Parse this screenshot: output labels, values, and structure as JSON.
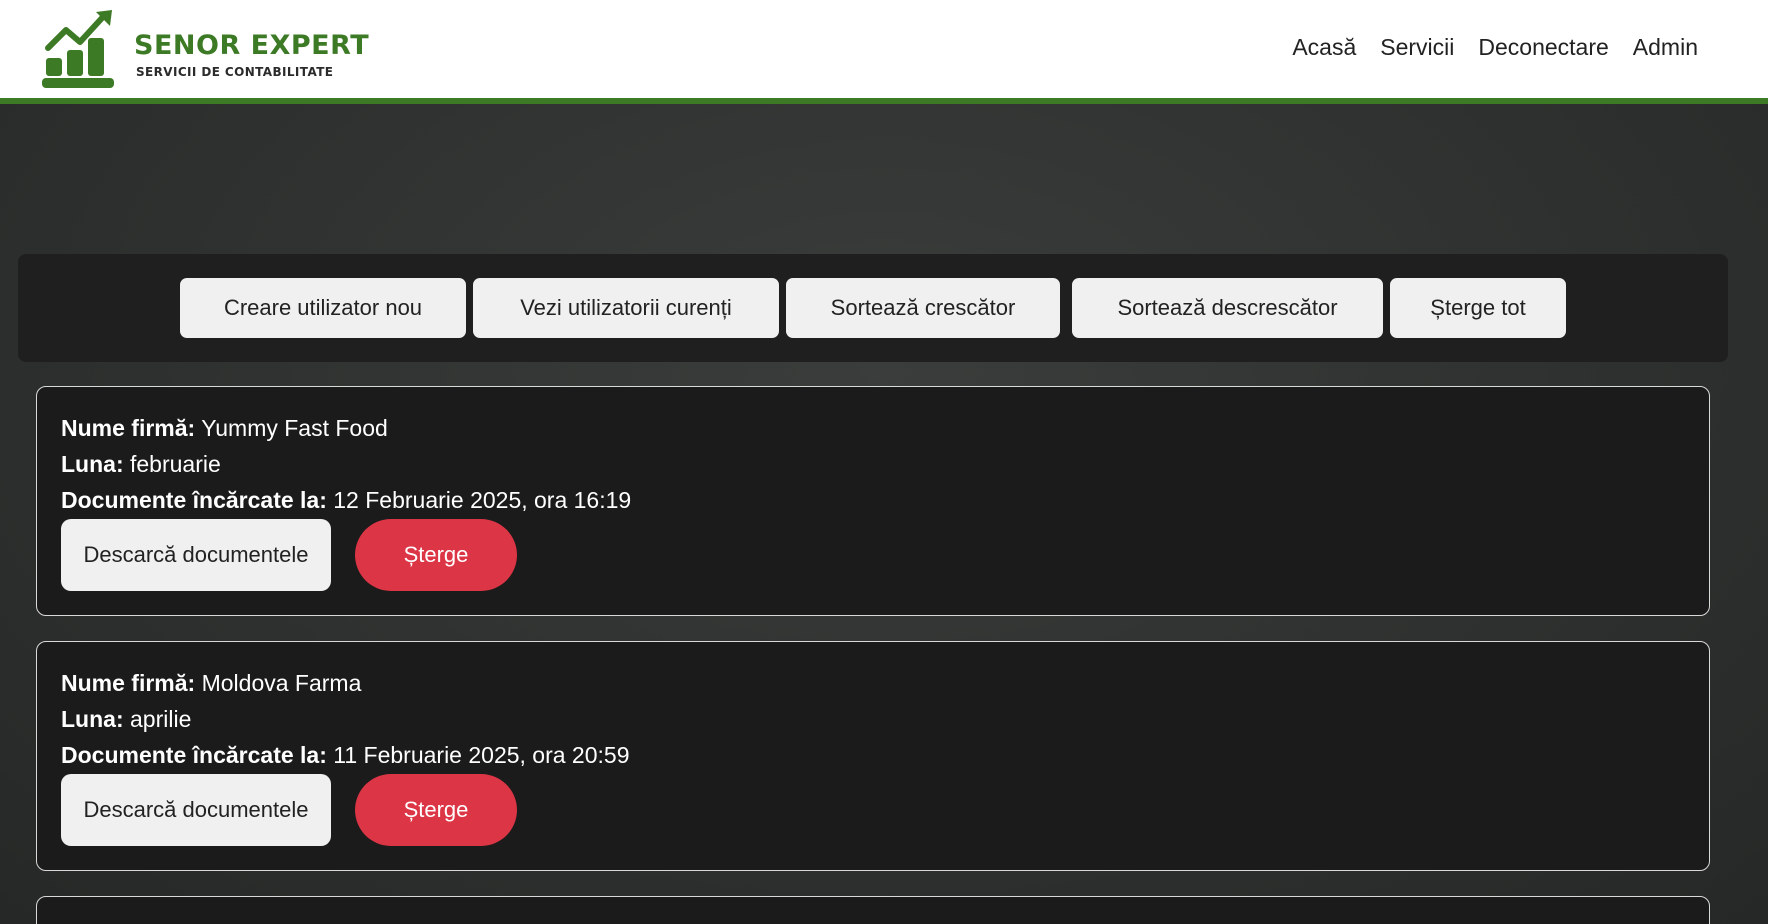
{
  "brand": {
    "title": "SENOR EXPERT",
    "subtitle": "SERVICII DE CONTABILITATE",
    "accent": "#3d7a25"
  },
  "nav": {
    "home": "Acasă",
    "services": "Servicii",
    "logout": "Deconectare",
    "admin": "Admin"
  },
  "toolbar": {
    "create_user": "Creare utilizator nou",
    "view_users": "Vezi utilizatorii curenți",
    "sort_asc": "Sortează crescător",
    "sort_desc": "Sortează descrescător",
    "delete_all": "Șterge tot"
  },
  "labels": {
    "company": "Nume firmă:",
    "month": "Luna:",
    "uploaded": "Documente încărcate la:",
    "download": "Descarcă documentele",
    "delete": "Șterge"
  },
  "records": [
    {
      "company": "Yummy Fast Food",
      "month": "februarie",
      "uploaded": "12 Februarie 2025, ora 16:19"
    },
    {
      "company": "Moldova Farma",
      "month": "aprilie",
      "uploaded": "11 Februarie 2025, ora 20:59"
    }
  ],
  "colors": {
    "delete": "#dc3545",
    "card_bg": "#1b1b1b"
  }
}
